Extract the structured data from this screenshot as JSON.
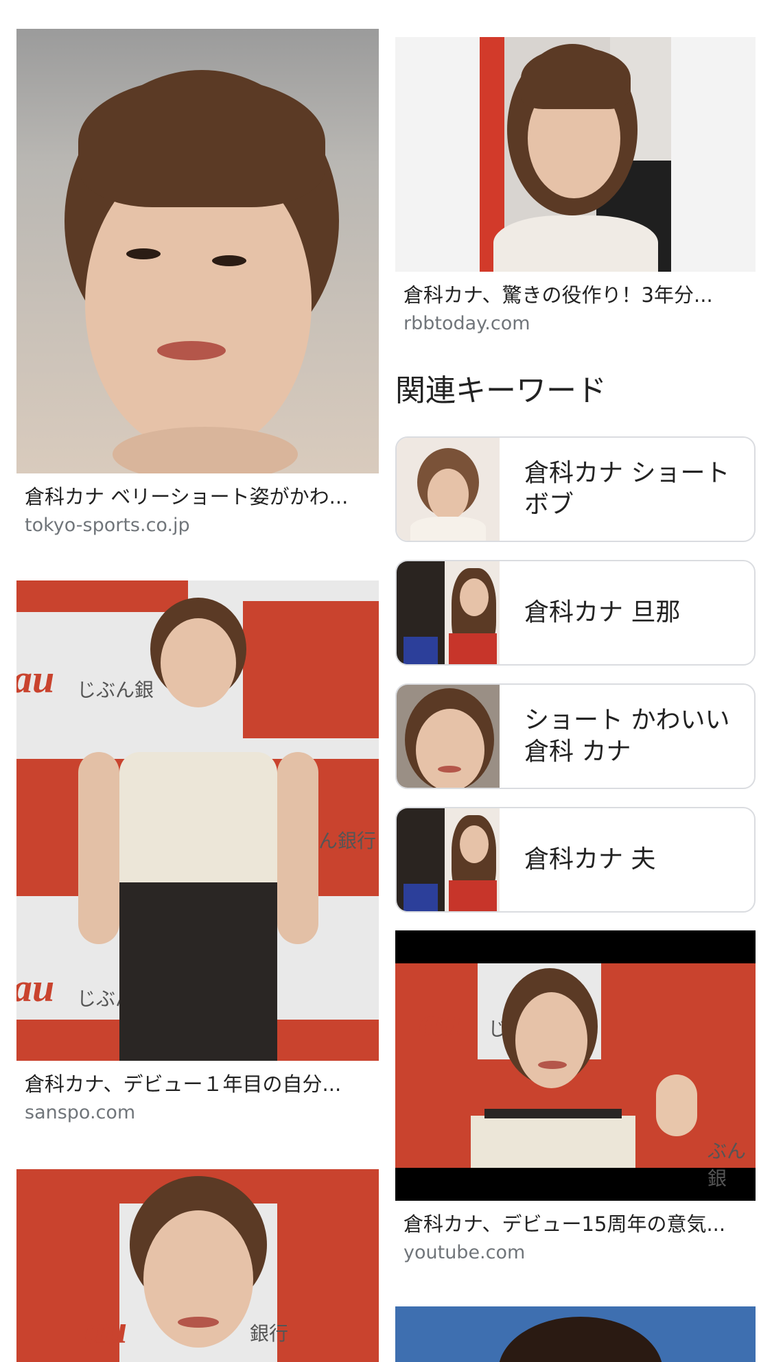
{
  "left_column": [
    {
      "title": "倉科カナ ベリーショート姿がかわ...",
      "source": "tokyo-sports.co.jp"
    },
    {
      "title": "倉科カナ、デビュー１年目の自分...",
      "source": "sanspo.com"
    },
    {
      "title": "",
      "source": ""
    }
  ],
  "right_column": [
    {
      "title": "倉科カナ、驚きの役作り！3年分...",
      "source": "rbbtoday.com"
    },
    {
      "title": "倉科カナ、デビュー15周年の意気...",
      "source": "youtube.com"
    }
  ],
  "related": {
    "heading": "関連キーワード",
    "items": [
      {
        "label": "倉科カナ ショート ボブ"
      },
      {
        "label": "倉科カナ 旦那"
      },
      {
        "label": "ショート かわいい 倉科 カナ"
      },
      {
        "label": "倉科カナ 夫"
      }
    ]
  },
  "photo_text": {
    "au_logo": "au",
    "bank_left": "じぶん銀",
    "bank_right": "ん銀行",
    "bank_left_2": "じぶん",
    "bank_right_3": "銀行",
    "yt_left": "じ",
    "yt_right": "ぶん銀"
  },
  "colors": {
    "background": "#ffffff",
    "caption_title": "#222222",
    "caption_source": "#70757a",
    "card_border": "#dadce0",
    "au_red": "#c9432e"
  }
}
